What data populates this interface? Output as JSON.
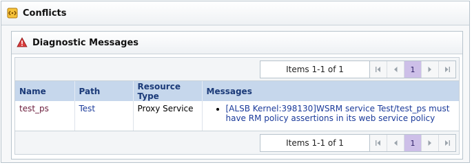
{
  "conflicts": {
    "title": "Conflicts",
    "icon": "conflicts-icon"
  },
  "diagnostics": {
    "title": "Diagnostic Messages",
    "icon": "warning-icon",
    "pager_top": {
      "items_label": "Items 1-1 of 1",
      "page": "1",
      "buttons": [
        "first-page",
        "previous-page",
        "next-page",
        "last-page"
      ]
    },
    "pager_bottom": {
      "items_label": "Items 1-1 of 1",
      "page": "1"
    },
    "table": {
      "headers": [
        "Name",
        "Path",
        "Resource Type",
        "Messages"
      ],
      "rows": [
        {
          "name": "test_ps",
          "path": "Test",
          "resource_type": "Proxy Service",
          "messages": [
            "[ALSB Kernel:398130]WSRM service Test/test_ps must have RM policy assertions in its web service policy"
          ]
        }
      ]
    }
  },
  "colors": {
    "header_bg": "#c6d7ec",
    "header_text": "#1b3a78",
    "current_page_bg": "#cdbfe8",
    "name_link": "#6a1b3a",
    "path_link": "#1a3a9a"
  }
}
